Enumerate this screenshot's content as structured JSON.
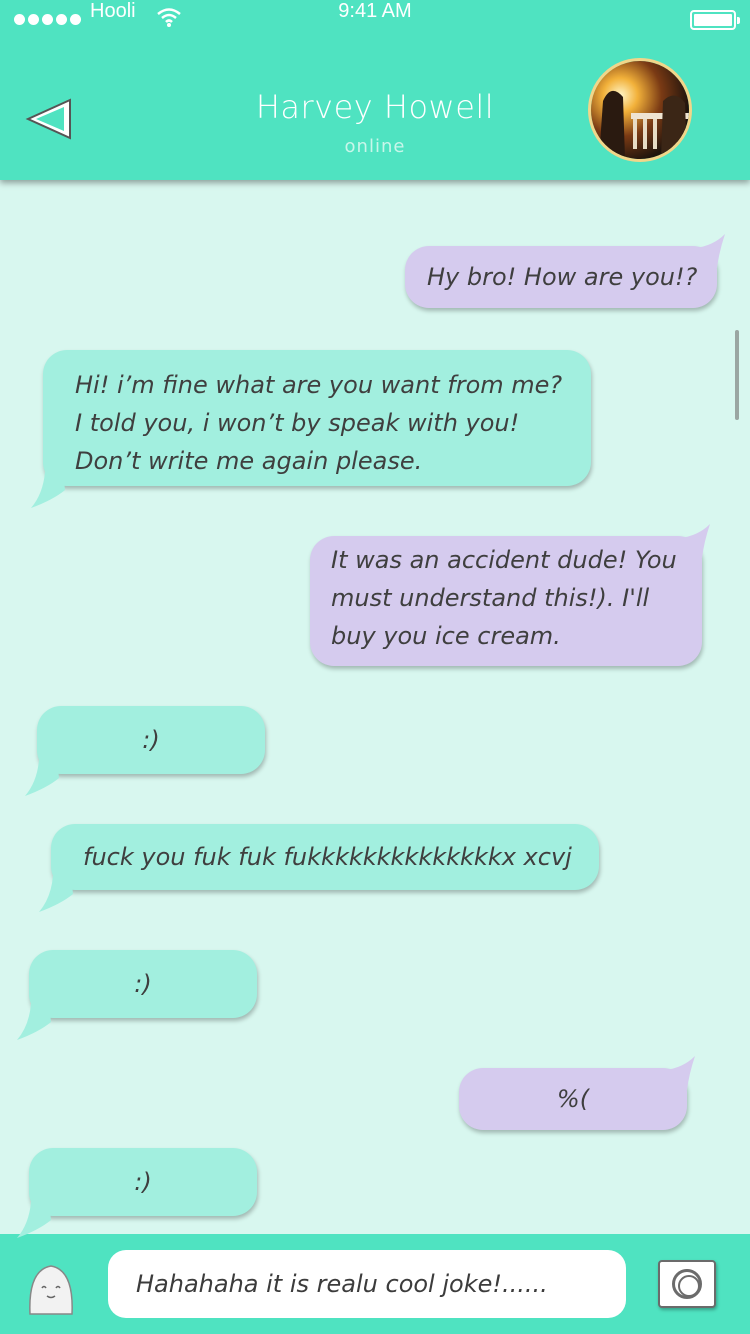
{
  "status_bar": {
    "carrier": "Hooli",
    "time": "9:41 AM",
    "battery_level": 1.0
  },
  "header": {
    "contact_name": "Harvey Howell",
    "contact_status": "online",
    "back_icon": "back-triangle-icon",
    "avatar": "contact-avatar-photo"
  },
  "colors": {
    "header_bg": "#4fe3c1",
    "chat_bg": "#d8f7ef",
    "outgoing_bubble": "#d5cbee",
    "incoming_bubble": "#a2efdf"
  },
  "messages": [
    {
      "direction": "outgoing",
      "text": "Hy bro! How are you!?"
    },
    {
      "direction": "incoming",
      "text": "Hi! i’m fine what are you want from me?\nI told you, i won’t by speak with you!\nDon’t write me again please."
    },
    {
      "direction": "outgoing",
      "text": "It was an accident dude! You\nmust understand this!). I'll\nbuy you ice cream."
    },
    {
      "direction": "incoming",
      "text": ":)"
    },
    {
      "direction": "incoming",
      "text": "fuck you fuk fuk fukkkkkkkkkkkkkkx xcvj"
    },
    {
      "direction": "incoming",
      "text": ":)"
    },
    {
      "direction": "outgoing",
      "text": "%("
    },
    {
      "direction": "incoming",
      "text": ":)"
    }
  ],
  "input_bar": {
    "message_value": "Hahahaha it is realu cool joke!......",
    "emoji_icon": "smiley-face-icon",
    "camera_icon": "camera-icon"
  }
}
